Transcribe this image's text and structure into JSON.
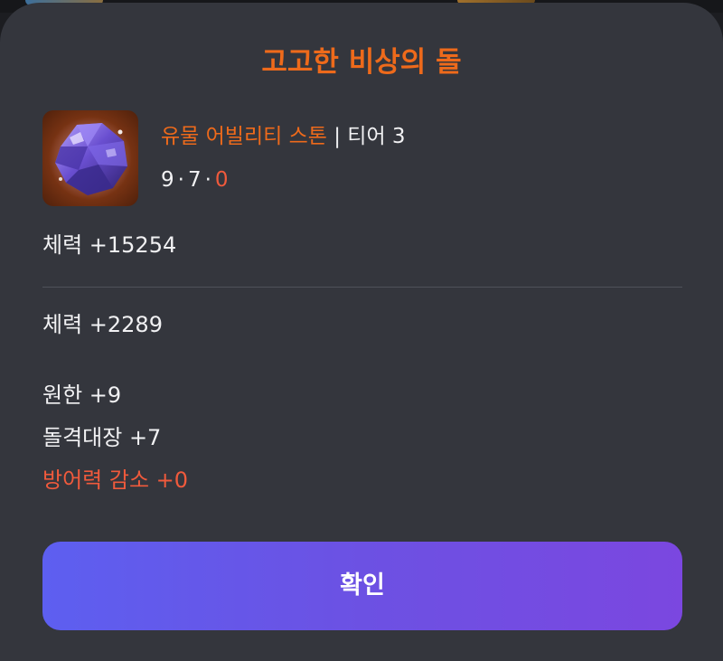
{
  "dialog": {
    "title": "고고한 비상의 돌"
  },
  "item": {
    "icon_name": "ability-stone-icon",
    "category": "유물 어빌리티 스톤",
    "separator": "|",
    "tier": "티어 3",
    "facets": {
      "first": "9",
      "second": "7",
      "third": "0",
      "dot": "·"
    }
  },
  "stats": {
    "base": "체력 +15254",
    "bonus": "체력 +2289",
    "engraving_1": "원한 +9",
    "engraving_2": "돌격대장 +7",
    "penalty": "방어력 감소 +0"
  },
  "button": {
    "confirm_label": "확인"
  },
  "colors": {
    "accent_orange": "#ee6a1b",
    "penalty_red": "#f05a3c",
    "sheet_bg": "#34363d",
    "button_gradient_start": "#5d5ff0",
    "button_gradient_end": "#7b47e0"
  }
}
